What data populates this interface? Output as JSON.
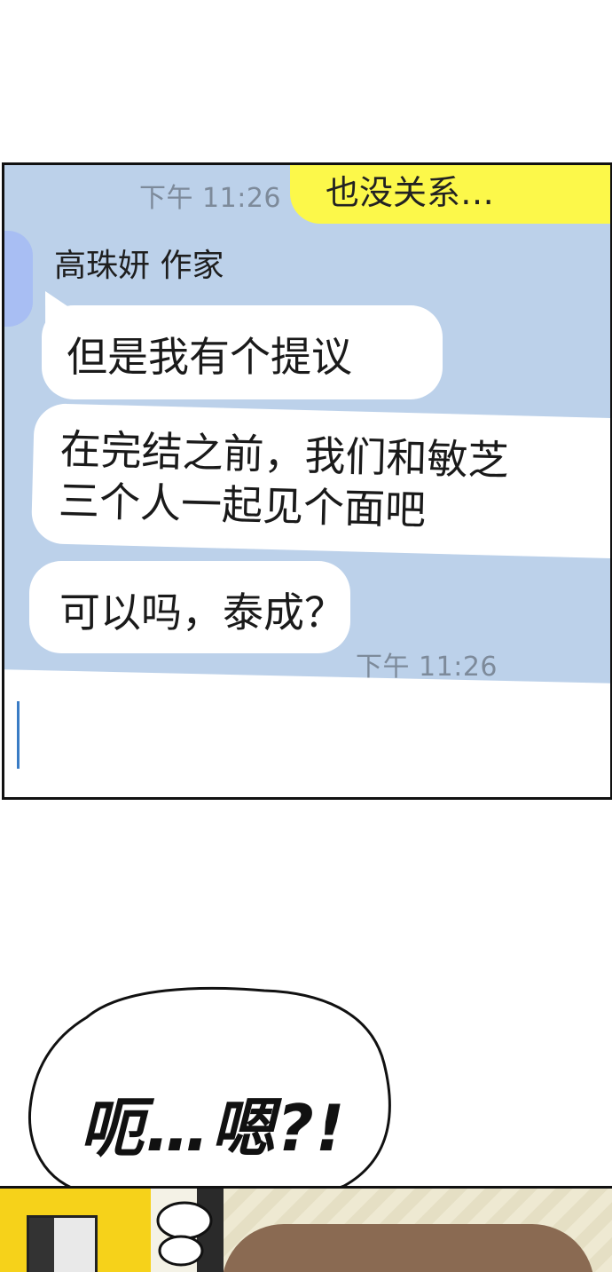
{
  "chat": {
    "top_time": "下午 11:26",
    "outgoing_partial": "也没关系…",
    "sender_name": "高珠妍 作家",
    "messages": [
      {
        "lines": [
          "但是我有个提议"
        ]
      },
      {
        "lines": [
          "在完结之前，我们和敏芝",
          "三个人一起见个面吧"
        ]
      },
      {
        "lines": [
          "可以吗，泰成？"
        ]
      }
    ],
    "bottom_time": "下午 11:26"
  },
  "thought_bubble": {
    "text": "呃…嗯?!"
  },
  "colors": {
    "chat_background": "#bcd1ea",
    "outgoing_bubble": "#fcf84a",
    "incoming_bubble": "#ffffff",
    "timestamp": "#7d8a9a",
    "cursor": "#3a7cc5"
  }
}
